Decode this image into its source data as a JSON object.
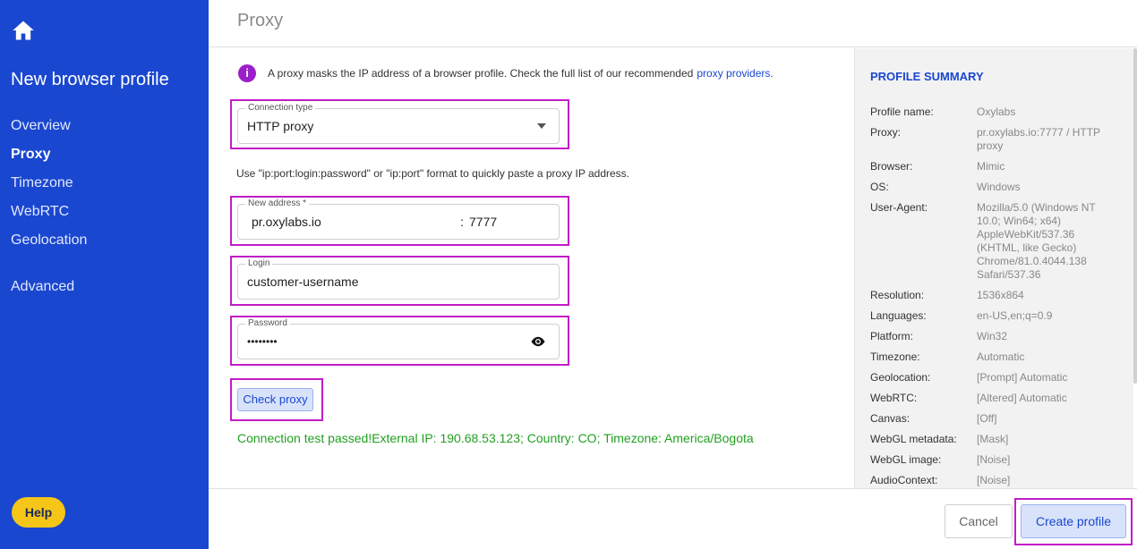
{
  "sidebar": {
    "title": "New browser profile",
    "items": [
      {
        "label": "Overview"
      },
      {
        "label": "Proxy"
      },
      {
        "label": "Timezone"
      },
      {
        "label": "WebRTC"
      },
      {
        "label": "Geolocation"
      },
      {
        "label": "Advanced"
      }
    ],
    "active_item": "Proxy",
    "help_label": "Help"
  },
  "header": {
    "title": "Proxy"
  },
  "info": {
    "icon": "i",
    "text": "A proxy masks the IP address of a browser profile. Check the full list of our recommended",
    "link": "proxy providers",
    "suffix": "."
  },
  "connection_type": {
    "label": "Connection type",
    "value": "HTTP proxy"
  },
  "hint": "Use \"ip:port:login:password\" or \"ip:port\" format to quickly paste a proxy IP address.",
  "address": {
    "label": "New address *",
    "host": "pr.oxylabs.io",
    "separator": ":",
    "port": "7777"
  },
  "login": {
    "label": "Login",
    "value": "customer-username"
  },
  "password": {
    "label": "Password",
    "value": "••••••••"
  },
  "check_proxy_label": "Check proxy",
  "test_result": "Connection test passed!External IP: 190.68.53.123; Country: CO; Timezone: America/Bogota",
  "summary": {
    "title": "PROFILE SUMMARY",
    "rows": [
      {
        "key": "Profile name:",
        "value": "Oxylabs"
      },
      {
        "key": "Proxy:",
        "value": "pr.oxylabs.io:7777 / HTTP proxy"
      },
      {
        "key": "Browser:",
        "value": "Mimic"
      },
      {
        "key": "OS:",
        "value": "Windows"
      },
      {
        "key": "User-Agent:",
        "value": "Mozilla/5.0 (Windows NT 10.0; Win64; x64) AppleWebKit/537.36 (KHTML, like Gecko) Chrome/81.0.4044.138 Safari/537.36"
      },
      {
        "key": "Resolution:",
        "value": "1536x864"
      },
      {
        "key": "Languages:",
        "value": "en-US,en;q=0.9"
      },
      {
        "key": "Platform:",
        "value": "Win32"
      },
      {
        "key": "Timezone:",
        "value": "Automatic"
      },
      {
        "key": "Geolocation:",
        "value": "[Prompt] Automatic"
      },
      {
        "key": "WebRTC:",
        "value": "[Altered] Automatic"
      },
      {
        "key": "Canvas:",
        "value": "[Off]"
      },
      {
        "key": "WebGL metadata:",
        "value": "[Mask]"
      },
      {
        "key": "WebGL image:",
        "value": "[Noise]"
      },
      {
        "key": "AudioContext:",
        "value": "[Noise]"
      }
    ]
  },
  "footer": {
    "cancel_label": "Cancel",
    "create_label": "Create profile"
  },
  "colors": {
    "sidebar": "#1a47cf",
    "accent": "#1a47cf",
    "highlight": "#c11cc6",
    "success": "#22a022",
    "help": "#f5c518"
  }
}
